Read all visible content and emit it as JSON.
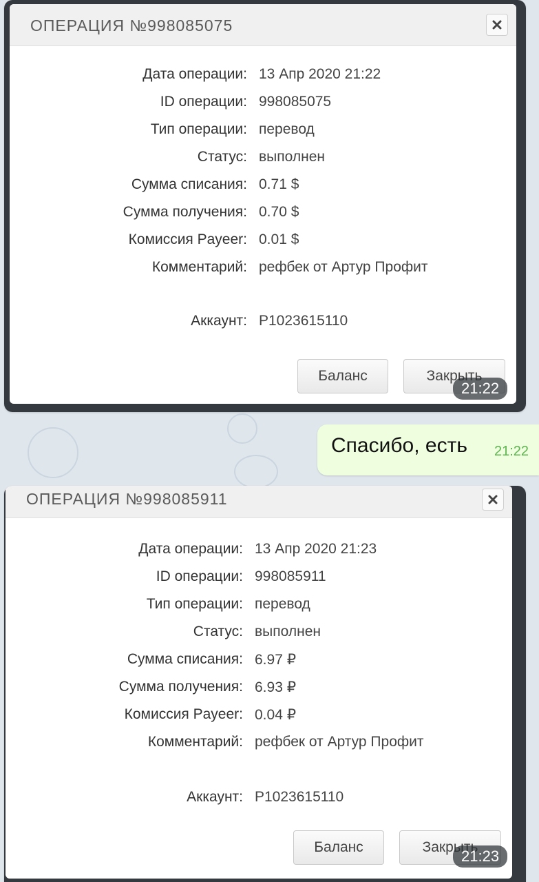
{
  "messages": [
    {
      "title": "ОПЕРАЦИЯ №998085075",
      "rows": [
        {
          "label": "Дата операции:",
          "value": "13 Апр 2020 21:22"
        },
        {
          "label": "ID операции:",
          "value": "998085075"
        },
        {
          "label": "Тип операции:",
          "value": "перевод"
        },
        {
          "label": "Статус:",
          "value": "выполнен"
        },
        {
          "label": "Сумма списания:",
          "value": "0.71 $"
        },
        {
          "label": "Сумма получения:",
          "value": "0.70 $"
        },
        {
          "label": "Комиссия Payeer:",
          "value": "0.01 $"
        },
        {
          "label": "Комментарий:",
          "value": "рефбек от Артур Профит"
        }
      ],
      "account_label": "Аккаунт:",
      "account_value": "P1023615110",
      "balance_label": "Баланс",
      "close_label": "Закрыть",
      "time": "21:22"
    },
    {
      "title": "ОПЕРАЦИЯ №998085911",
      "rows": [
        {
          "label": "Дата операции:",
          "value": "13 Апр 2020 21:23"
        },
        {
          "label": "ID операции:",
          "value": "998085911"
        },
        {
          "label": "Тип операции:",
          "value": "перевод"
        },
        {
          "label": "Статус:",
          "value": "выполнен"
        },
        {
          "label": "Сумма списания:",
          "value": "6.97 ₽"
        },
        {
          "label": "Сумма получения:",
          "value": "6.93 ₽"
        },
        {
          "label": "Комиссия Payeer:",
          "value": "0.04 ₽"
        },
        {
          "label": "Комментарий:",
          "value": "рефбек от Артур Профит"
        }
      ],
      "account_label": "Аккаунт:",
      "account_value": "P1023615110",
      "balance_label": "Баланс",
      "close_label": "Закрыть",
      "time": "21:23"
    }
  ],
  "reply": {
    "text": "Спасибо, есть",
    "time": "21:22"
  },
  "colors": {
    "bubble": "#eefedf",
    "bubble_time": "#5db54e",
    "frame": "#34393f"
  },
  "icons": {
    "close": "close-icon"
  }
}
